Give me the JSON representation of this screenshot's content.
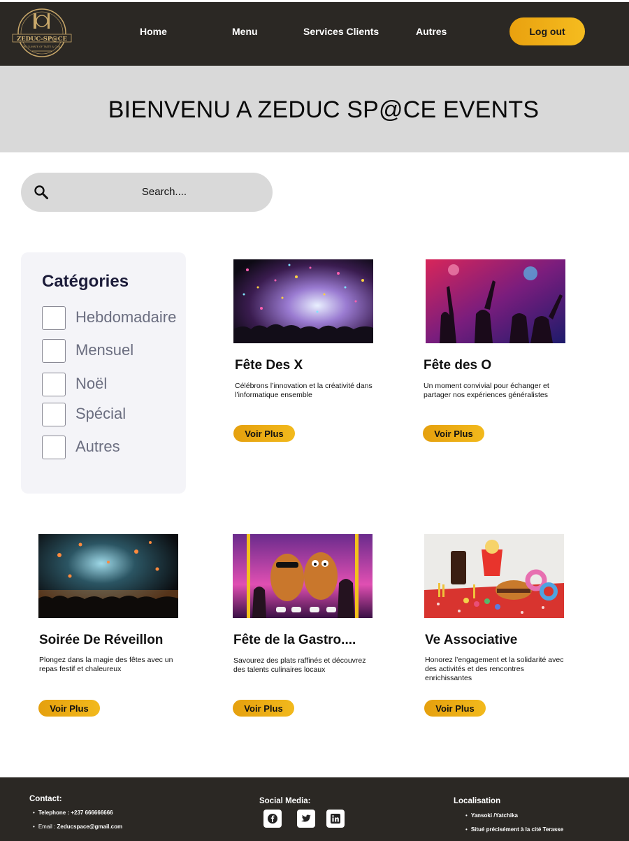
{
  "navbar": {
    "logo_text": "ZEDUC-SP@CE",
    "logo_tagline": "THE CLIMATE OF TASTE & CHILL",
    "links": [
      "Home",
      "Menu",
      "Services Clients",
      "Autres"
    ],
    "logout_label": "Log out"
  },
  "hero": {
    "title": "BIENVENU A ZEDUC SP@CE EVENTS"
  },
  "search": {
    "placeholder": "Search...."
  },
  "categories": {
    "title": "Catégories",
    "items": [
      "Hebdomadaire",
      "Mensuel",
      "Noël",
      "Spécial",
      "Autres"
    ]
  },
  "events": [
    {
      "title": "Fête Des X",
      "description": "Célébrons l’innovation et la créativité dans l’informatique ensemble",
      "button": "Voir Plus"
    },
    {
      "title": "Fête des O",
      "description": "Un moment convivial pour échanger et partager nos expériences généralistes",
      "button": "Voir Plus"
    },
    {
      "title": "Soirée De Réveillon",
      "description": " Plongez dans la magie des fêtes avec un repas festif et chaleureux",
      "button": "Voir Plus"
    },
    {
      "title": "Fête de la Gastro....",
      "description": "Savourez des plats raffinés et découvrez des talents culinaires locaux",
      "button": "Voir Plus"
    },
    {
      "title": "Ve Associative",
      "description": "Honorez l’engagement et la solidarité avec des activités et des rencontres enrichissantes",
      "button": "Voir Plus"
    }
  ],
  "footer": {
    "contact_title": "Contact:",
    "phone": "Telephone : +237 666666666",
    "email_label": "Email : ",
    "email_value": "Zeducspace@gmail.com",
    "social_title": "Social Media:",
    "social_icons": [
      "facebook-icon",
      "twitter-icon",
      "linkedin-icon"
    ],
    "location_title": "Localisation",
    "location_items": [
      "Yansoki /Yatchika",
      "Situé précisément à la cité Terasse"
    ]
  },
  "colors": {
    "dark": "#2b2824",
    "accent": "#f0b117",
    "hero_bg": "#d9d9d9",
    "panel_bg": "#f4f4f8"
  }
}
